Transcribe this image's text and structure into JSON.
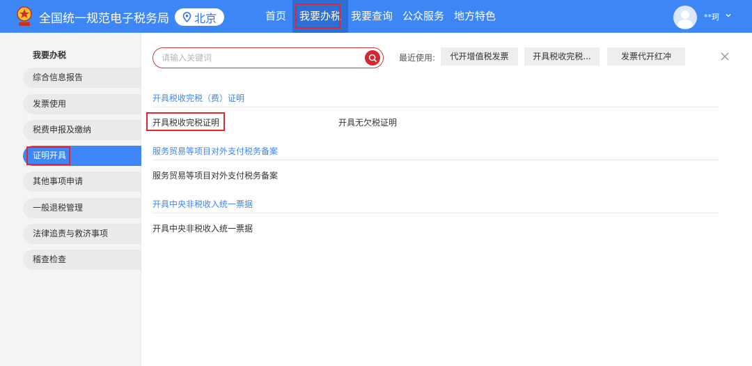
{
  "header": {
    "site_title": "全国统一规范电子税务局",
    "region": "北京",
    "nav": [
      {
        "label": "首页"
      },
      {
        "label": "我要办税"
      },
      {
        "label": "我要查询"
      },
      {
        "label": "公众服务"
      },
      {
        "label": "地方特色"
      }
    ],
    "active_nav": "我要办税",
    "user_name": "**珂",
    "accent_color": "#3d86f5"
  },
  "sidebar": {
    "title": "我要办税",
    "items": [
      {
        "label": "综合信息报告"
      },
      {
        "label": "发票使用"
      },
      {
        "label": "税费申报及缴纳"
      },
      {
        "label": "证明开具"
      },
      {
        "label": "其他事项申请"
      },
      {
        "label": "一般退税管理"
      },
      {
        "label": "法律追责与救济事项"
      },
      {
        "label": "稽查检查"
      }
    ],
    "active_item": "证明开具"
  },
  "search": {
    "placeholder": "请输入关键词",
    "value": ""
  },
  "recent": {
    "label": "最近使用:",
    "items": [
      {
        "label": "代开增值税发票"
      },
      {
        "label": "开具税收完税..."
      },
      {
        "label": "发票代开红冲"
      }
    ]
  },
  "sections": [
    {
      "title": "开具税收完税（费）证明",
      "links": [
        {
          "label": "开具税收完税证明"
        },
        {
          "label": "开具无欠税证明"
        }
      ]
    },
    {
      "title": "服务贸易等项目对外支付税务备案",
      "links": [
        {
          "label": "服务贸易等项目对外支付税务备案"
        }
      ]
    },
    {
      "title": "开具中央非税收入统一票据",
      "links": [
        {
          "label": "开具中央非税收入统一票据"
        }
      ]
    }
  ],
  "icons": {
    "logo": "tax-emblem-icon",
    "region": "location-pin-icon",
    "search": "search-icon",
    "user": "user-avatar-icon",
    "dropdown": "chevron-down-icon",
    "close": "close-icon"
  },
  "highlight_color": "#e3252f"
}
